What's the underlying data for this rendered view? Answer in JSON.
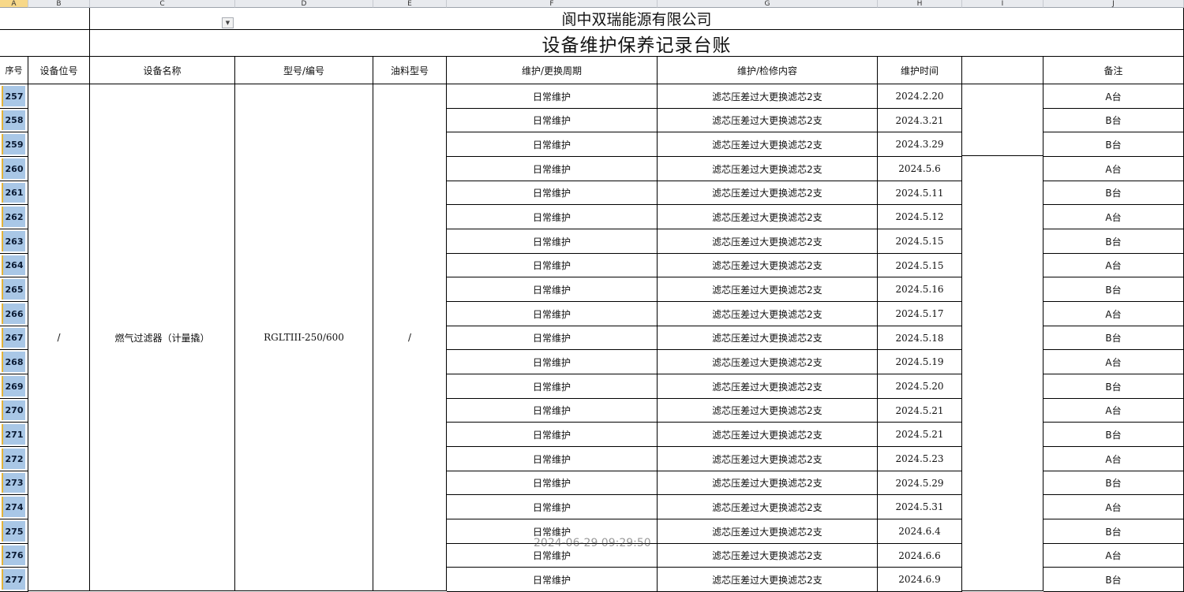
{
  "columns": [
    "A",
    "B",
    "C",
    "D",
    "E",
    "F",
    "G",
    "H",
    "I",
    "J"
  ],
  "company": "阆中双瑞能源有限公司",
  "title": "设备维护保养记录台账",
  "headers": {
    "index": "序号",
    "position": "设备位号",
    "name": "设备名称",
    "model": "型号/编号",
    "oil": "油料型号",
    "cycle": "维护/更换周期",
    "content": "维护/检修内容",
    "time": "维护时间",
    "blank": "",
    "note": "备注"
  },
  "equipment": {
    "position": "/",
    "name": "燃气过滤器（计量撬）",
    "model": "RGLTIII-250/600",
    "oil": "/"
  },
  "rows": [
    {
      "n": "257",
      "cycle": "日常维护",
      "content": "滤芯压差过大更换滤芯2支",
      "time": "2024.2.20",
      "note": "A台"
    },
    {
      "n": "258",
      "cycle": "日常维护",
      "content": "滤芯压差过大更换滤芯2支",
      "time": "2024.3.21",
      "note": "B台"
    },
    {
      "n": "259",
      "cycle": "日常维护",
      "content": "滤芯压差过大更换滤芯2支",
      "time": "2024.3.29",
      "note": "B台"
    },
    {
      "n": "260",
      "cycle": "日常维护",
      "content": "滤芯压差过大更换滤芯2支",
      "time": "2024.5.6",
      "note": "A台"
    },
    {
      "n": "261",
      "cycle": "日常维护",
      "content": "滤芯压差过大更换滤芯2支",
      "time": "2024.5.11",
      "note": "B台"
    },
    {
      "n": "262",
      "cycle": "日常维护",
      "content": "滤芯压差过大更换滤芯2支",
      "time": "2024.5.12",
      "note": "A台"
    },
    {
      "n": "263",
      "cycle": "日常维护",
      "content": "滤芯压差过大更换滤芯2支",
      "time": "2024.5.15",
      "note": "B台"
    },
    {
      "n": "264",
      "cycle": "日常维护",
      "content": "滤芯压差过大更换滤芯2支",
      "time": "2024.5.15",
      "note": "A台"
    },
    {
      "n": "265",
      "cycle": "日常维护",
      "content": "滤芯压差过大更换滤芯2支",
      "time": "2024.5.16",
      "note": "B台"
    },
    {
      "n": "266",
      "cycle": "日常维护",
      "content": "滤芯压差过大更换滤芯2支",
      "time": "2024.5.17",
      "note": "A台"
    },
    {
      "n": "267",
      "cycle": "日常维护",
      "content": "滤芯压差过大更换滤芯2支",
      "time": "2024.5.18",
      "note": "B台"
    },
    {
      "n": "268",
      "cycle": "日常维护",
      "content": "滤芯压差过大更换滤芯2支",
      "time": "2024.5.19",
      "note": "A台"
    },
    {
      "n": "269",
      "cycle": "日常维护",
      "content": "滤芯压差过大更换滤芯2支",
      "time": "2024.5.20",
      "note": "B台"
    },
    {
      "n": "270",
      "cycle": "日常维护",
      "content": "滤芯压差过大更换滤芯2支",
      "time": "2024.5.21",
      "note": "A台"
    },
    {
      "n": "271",
      "cycle": "日常维护",
      "content": "滤芯压差过大更换滤芯2支",
      "time": "2024.5.21",
      "note": "B台"
    },
    {
      "n": "272",
      "cycle": "日常维护",
      "content": "滤芯压差过大更换滤芯2支",
      "time": "2024.5.23",
      "note": "A台"
    },
    {
      "n": "273",
      "cycle": "日常维护",
      "content": "滤芯压差过大更换滤芯2支",
      "time": "2024.5.29",
      "note": "B台"
    },
    {
      "n": "274",
      "cycle": "日常维护",
      "content": "滤芯压差过大更换滤芯2支",
      "time": "2024.5.31",
      "note": "A台"
    },
    {
      "n": "275",
      "cycle": "日常维护",
      "content": "滤芯压差过大更换滤芯2支",
      "time": "2024.6.4",
      "note": "B台"
    },
    {
      "n": "276",
      "cycle": "日常维护",
      "content": "滤芯压差过大更换滤芯2支",
      "time": "2024.6.6",
      "note": "A台"
    },
    {
      "n": "277",
      "cycle": "日常维护",
      "content": "滤芯压差过大更换滤芯2支",
      "time": "2024.6.9",
      "note": "B台"
    }
  ],
  "dropdown_icon": "chevron-down-icon",
  "watermark": "2024-06-29 09:29:50",
  "colors": {
    "row_header": "#a9c7e6",
    "selected_col": "#f7d889",
    "accent": "#e4b43a"
  }
}
